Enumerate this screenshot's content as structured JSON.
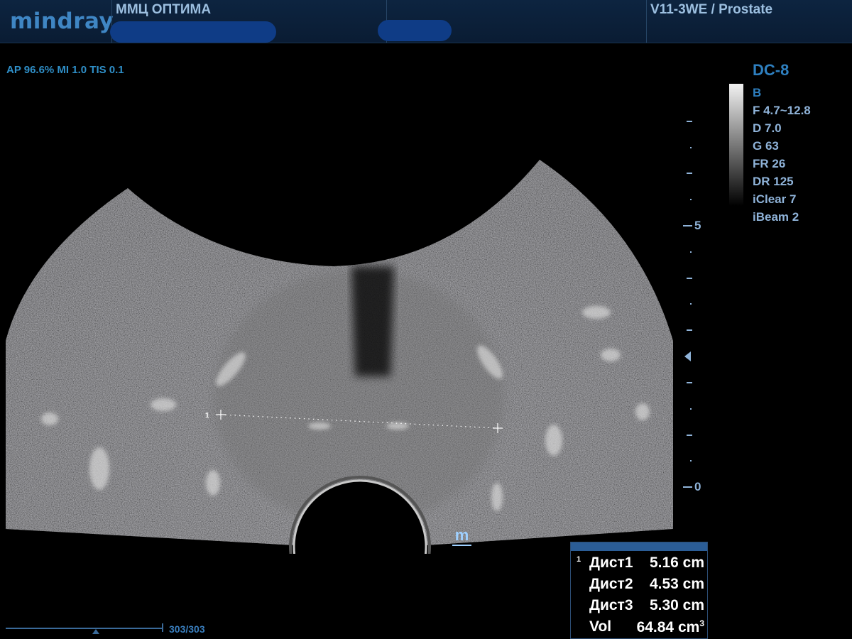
{
  "header": {
    "logo": "mindray",
    "hospital": "ММЦ ОПТИМА",
    "probe_preset": "V11-3WE / Prostate"
  },
  "safety": "AP 96.6%  MI 1.0 TIS 0.1",
  "imaging": {
    "preset_code": "DC-8",
    "mode": "B",
    "params": [
      "F 4.7~12.8",
      "D 7.0",
      "G 63",
      "FR 26",
      "DR 125",
      "iClear 7",
      "iBeam 2"
    ]
  },
  "depth_scale": {
    "labels": [
      "5",
      "0"
    ]
  },
  "caliper": {
    "label": "1"
  },
  "results": {
    "rows": [
      {
        "index": "1",
        "label": "Дист1",
        "value": "5.16 cm"
      },
      {
        "index": "",
        "label": "Дист2",
        "value": "4.53 cm"
      },
      {
        "index": "",
        "label": "Дист3",
        "value": "5.30 cm"
      },
      {
        "index": "",
        "label": "Vol",
        "value": "64.84 cm",
        "unit_sup": "3"
      }
    ]
  },
  "cine": {
    "counter": "303/303"
  },
  "colors": {
    "header_bg": "#0a1c33",
    "accent": "#2e7fbf",
    "text": "#8fb3d9",
    "results_header": "#2b5d96"
  }
}
